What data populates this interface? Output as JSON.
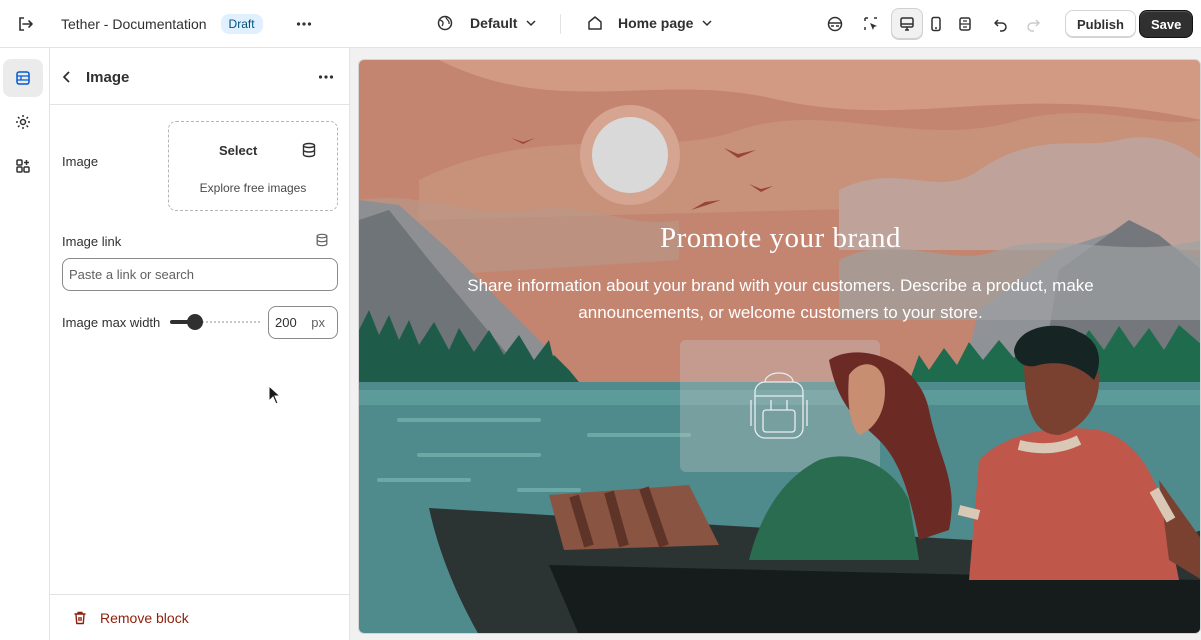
{
  "topbar": {
    "exit_icon": "exit-icon",
    "store_title": "Tether - Documentation",
    "status_badge": "Draft",
    "theme_select": "Default",
    "page_select": "Home page",
    "publish_label": "Publish",
    "save_label": "Save"
  },
  "rail": {
    "items": [
      "sections-icon",
      "settings-gear-icon",
      "apps-icon"
    ]
  },
  "panel": {
    "title": "Image",
    "image_label": "Image",
    "select_label": "Select",
    "explore_label": "Explore free images",
    "image_link_label": "Image link",
    "link_placeholder": "Paste a link or search",
    "max_width_label": "Image max width",
    "max_width_value": "200",
    "max_width_unit": "px",
    "slider_fraction": 0.3,
    "remove_label": "Remove block"
  },
  "preview": {
    "heading": "Promote your brand",
    "body": "Share information about your brand with your customers. Describe a product, make announcements, or welcome customers to your store."
  },
  "colors": {
    "accent_dark": "#303030",
    "draft_badge_bg": "#e0f0ff",
    "danger": "#8e1f0b",
    "sky": "#c98f75",
    "water": "#4d8a8c"
  }
}
